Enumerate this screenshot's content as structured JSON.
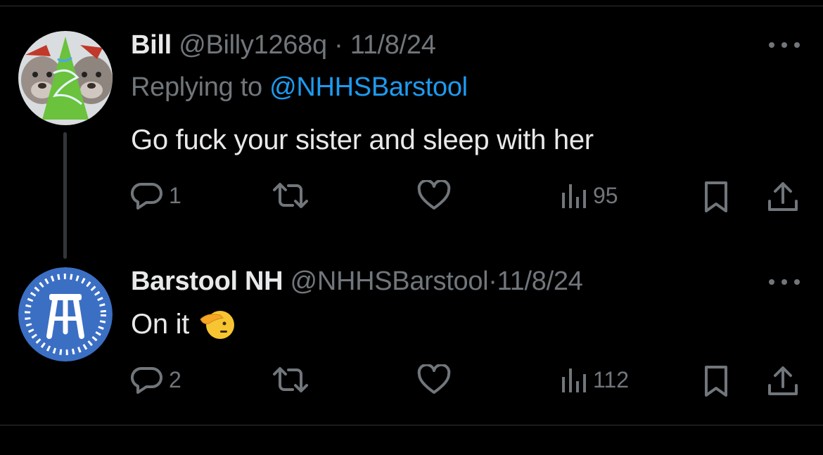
{
  "tweets": [
    {
      "name": "Bill",
      "handle": "@Billy1268q",
      "separator": "·",
      "date": "11/8/24",
      "replying_prefix": "Replying to ",
      "replying_to": "@NHHSBarstool",
      "text": "Go fuck your sister and sleep with her",
      "avatar": "dog-christmas-tree-avatar",
      "stats": {
        "replies": "1",
        "views": "95"
      }
    },
    {
      "name": "Barstool NH",
      "handle": "@NHHSBarstool",
      "separator": "·",
      "date": "11/8/24",
      "text": "On it",
      "emoji": "saluting-face-emoji",
      "avatar": "barstool-logo-avatar",
      "stats": {
        "replies": "2",
        "views": "112"
      }
    }
  ],
  "icons": {
    "reply": "reply-icon",
    "retweet": "retweet-icon",
    "like": "heart-icon",
    "views": "views-chart-icon",
    "bookmark": "bookmark-icon",
    "share": "share-icon",
    "more": "more-dots-icon"
  },
  "colors": {
    "background": "#000000",
    "text": "#e7e9ea",
    "secondary": "#71767b",
    "link": "#1d9bf0",
    "barstool_blue": "#3b6fc4"
  }
}
